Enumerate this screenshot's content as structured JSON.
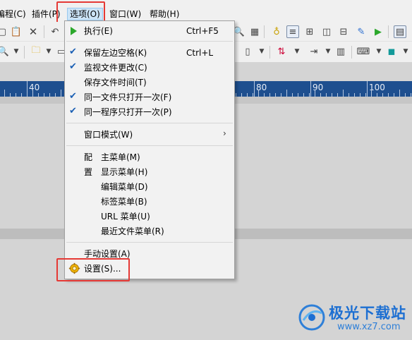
{
  "menubar": {
    "items": [
      {
        "label": "编程(C)"
      },
      {
        "label": "插件(P)"
      },
      {
        "label": "选项(O)"
      },
      {
        "label": "窗口(W)"
      },
      {
        "label": "帮助(H)"
      }
    ]
  },
  "ruler": {
    "labels": [
      "40",
      "80",
      "90",
      "100"
    ]
  },
  "options_menu": {
    "run": {
      "label": "执行(E)",
      "shortcut": "Ctrl+F5"
    },
    "keep_margin": {
      "label": "保留左边空格(K)",
      "shortcut": "Ctrl+L",
      "checked": true
    },
    "monitor_changes": {
      "label": "监视文件更改(C)",
      "checked": true
    },
    "save_file_time": {
      "label": "保存文件时间(T)",
      "checked": false
    },
    "one_file_once": {
      "label": "同一文件只打开一次(F)",
      "checked": true
    },
    "one_program_once": {
      "label": "同一程序只打开一次(P)",
      "checked": true
    },
    "window_mode": {
      "label": "窗口模式(W)",
      "submenu": true
    },
    "config_prefix": "配",
    "main_menu": {
      "label": "主菜单(M)"
    },
    "display_prefix": "置",
    "display_menu": {
      "label": "显示菜单(H)"
    },
    "edit_menu": {
      "label": "编辑菜单(D)"
    },
    "tab_menu": {
      "label": "标签菜单(B)"
    },
    "url_menu": {
      "label": "URL 菜单(U)"
    },
    "recent_menu": {
      "label": "最近文件菜单(R)"
    },
    "manual_settings": {
      "label": "手动设置(A)"
    },
    "settings": {
      "label": "设置(S)..."
    }
  },
  "watermark": {
    "title": "极光下载站",
    "url": "www.xz7.com"
  },
  "colors": {
    "highlight_box": "#e53935",
    "ruler_bg": "#1e4f8f",
    "check": "#1a5fb4"
  }
}
